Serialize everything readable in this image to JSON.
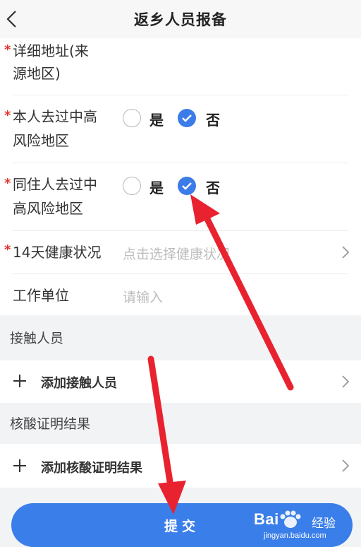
{
  "header": {
    "title": "返乡人员报备"
  },
  "form": {
    "address": {
      "line1": "详细地址(来",
      "line2": "源地区)"
    },
    "self_risk": {
      "line1": "本人去过中高",
      "line2": "风险地区",
      "yes": "是",
      "no": "否",
      "selected": "否"
    },
    "cohabit_risk": {
      "line1": "同住人去过中",
      "line2": "高风险地区",
      "yes": "是",
      "no": "否",
      "selected": "否"
    },
    "health": {
      "label": "14天健康状况",
      "placeholder": "点击选择健康状况"
    },
    "work": {
      "label": "工作单位",
      "placeholder": "请输入"
    }
  },
  "contacts": {
    "section": "接触人员",
    "add": "添加接触人员"
  },
  "nucleic": {
    "section": "核酸证明结果",
    "add": "添加核酸证明结果"
  },
  "submit": {
    "label": "提交"
  },
  "watermark": {
    "brand": "Bai",
    "text": "经验",
    "url": "jingyan.baidu.com"
  },
  "colors": {
    "accent": "#3b7ce8",
    "required": "#e0362c",
    "arrow": "#e8232f"
  }
}
